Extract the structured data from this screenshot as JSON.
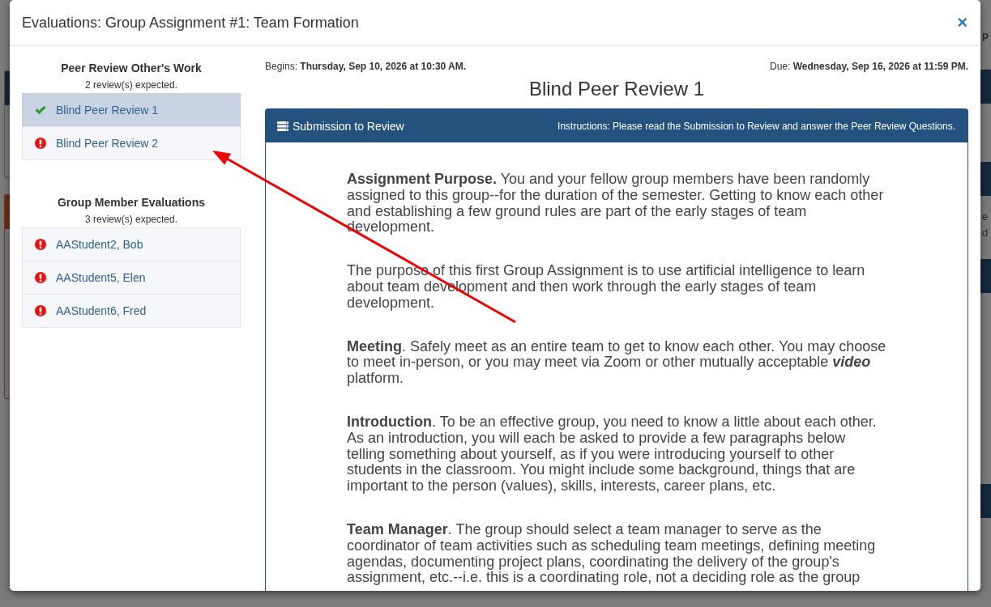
{
  "background": {
    "fragments": [
      "p",
      "e",
      "d"
    ]
  },
  "dialog": {
    "title": "Evaluations: Group Assignment #1: Team Formation",
    "close_glyph": "×"
  },
  "sidebar": {
    "sections": [
      {
        "heading": "Peer Review Other's Work",
        "note": "2 review(s) expected.",
        "items": [
          {
            "label": "Blind Peer Review 1",
            "complete": true,
            "selected": true
          },
          {
            "label": "Blind Peer Review 2",
            "complete": false,
            "selected": false
          }
        ]
      },
      {
        "heading": "Group Member Evaluations",
        "note": "3 review(s) expected.",
        "items": [
          {
            "label": "AAStudent2, Bob",
            "complete": false,
            "selected": false
          },
          {
            "label": "AAStudent5, Elen",
            "complete": false,
            "selected": false
          },
          {
            "label": "AAStudent6, Fred",
            "complete": false,
            "selected": false
          }
        ]
      }
    ]
  },
  "review": {
    "begins": "Begins: **Thursday, Sep 10, 2026 at 10:30 AM.**",
    "due": "Due: **Wednesday, Sep 16, 2026 at 11:59 PM.**",
    "title": "Blind Peer Review 1",
    "panel": {
      "title": "Submission to Review",
      "instructions": "Instructions: Please read the Submission to Review and answer the Peer Review Questions.",
      "paragraphs": [
        "**Assignment Purpose.** You and your fellow group members have been randomly assigned to this group--for the duration of the semester. Getting to know each other and establishing a few ground rules are part of the early stages of team development.",
        "The purpose of this first Group Assignment is to use artificial intelligence to learn about team development and then work through the early stages of team development.",
        "**Meeting**. Safely meet as an entire team to get to know each other. You may choose to meet in-person, or you may meet via Zoom or other mutually acceptable *video* platform.",
        "**Introduction**. To be an effective group, you need to know a little about each other. As an introduction, you will each be asked to provide a few paragraphs below telling something about yourself, as if you were introducing yourself to other students in the classroom. You might include some background, things that are important to the person (values), skills, interests, career plans, etc.",
        "**Team Manager**. The group should select a team manager to serve as the coordinator of team activities such as scheduling team meetings, defining meeting agendas, documenting project plans, coordinating the delivery of the group's assignment, etc.--i.e. this is a coordinating role, not a deciding role as the group"
      ]
    }
  }
}
